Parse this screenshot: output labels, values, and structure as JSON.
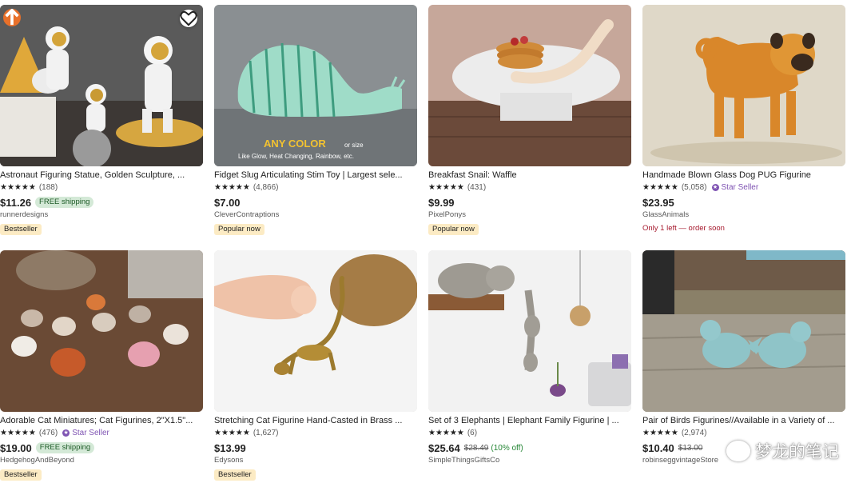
{
  "listings": [
    {
      "title": "Astronaut Figuring Statue, Golden Sculpture, ...",
      "stars": "★★★★★",
      "review_count": "(188)",
      "rating": 4.5,
      "price": "$11.26",
      "free_shipping": "FREE shipping",
      "shop": "runnerdesigns",
      "tag": "Bestseller",
      "image": "astronaut-figurines"
    },
    {
      "title": "Fidget Slug Articulating Stim Toy | Largest sele...",
      "stars": "★★★★★",
      "review_count": "(4,866)",
      "rating": 5,
      "price": "$7.00",
      "shop": "CleverContraptions",
      "tag": "Popular now",
      "image": "green-fidget-slug",
      "overlay_text_main": "ANY COLOR",
      "overlay_text_small": "or size",
      "overlay_text_sub": "Like Glow, Heat Changing, Rainbow, etc."
    },
    {
      "title": "Breakfast Snail: Waffle",
      "stars": "★★★★★",
      "review_count": "(431)",
      "rating": 5,
      "price": "$9.99",
      "shop": "PixelPonys",
      "tag": "Popular now",
      "image": "snail-with-pancakes"
    },
    {
      "title": "Handmade Blown Glass Dog PUG Figurine",
      "stars": "★★★★★",
      "review_count": "(5,058)",
      "rating": 5,
      "star_seller": "Star Seller",
      "price": "$23.95",
      "shop": "GlassAnimals",
      "scarcity": "Only 1 left — order soon",
      "image": "glass-pug"
    },
    {
      "title": "Adorable Cat Miniatures; Cat Figurines, 2\"X1.5\"...",
      "stars": "★★★★★",
      "review_count": "(476)",
      "rating": 5,
      "star_seller": "Star Seller",
      "price": "$19.00",
      "free_shipping": "FREE shipping",
      "shop": "HedgehogAndBeyond",
      "tag": "Bestseller",
      "image": "cat-miniatures"
    },
    {
      "title": "Stretching Cat Figurine Hand-Casted in Brass ...",
      "stars": "★★★★★",
      "review_count": "(1,627)",
      "rating": 5,
      "price": "$13.99",
      "shop": "Edysons",
      "tag": "Bestseller",
      "image": "brass-stretching-cat"
    },
    {
      "title": "Set of 3 Elephants | Elephant Family Figurine | ...",
      "stars": "★★★★★",
      "review_count": "(6)",
      "rating": 5,
      "price": "$25.64",
      "original_price": "$28.49",
      "discount": "(10% off)",
      "shop": "SimpleThingsGiftsCo",
      "image": "elephant-family-shelf"
    },
    {
      "title": "Pair of Birds Figurines//Available in a Variety of ...",
      "stars": "★★★★★",
      "review_count": "(2,974)",
      "rating": 5,
      "price": "$10.40",
      "original_price": "$13.00",
      "shop": "robinseggvintageStore",
      "image": "blue-bird-pair"
    }
  ],
  "favorite_icon": "heart-outline-icon",
  "watermark": "梦龙的笔记",
  "colors": {
    "star_seller": "#7f54b3",
    "free_shipping_bg": "#d4e9d7",
    "tag_bg": "#fcebc4",
    "discount_green": "#258635",
    "scarcity_red": "#a61a2e"
  }
}
